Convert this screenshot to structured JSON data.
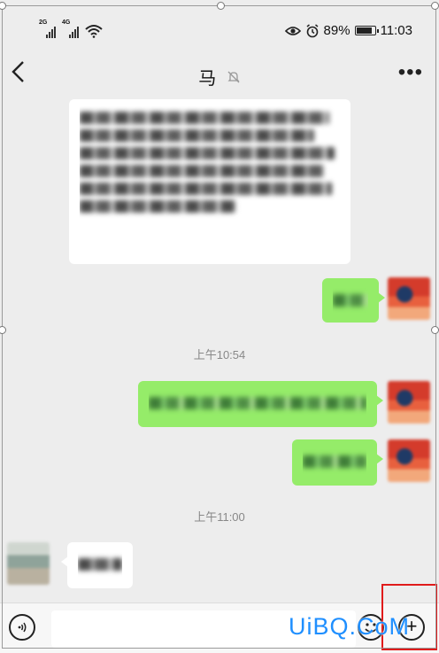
{
  "status_bar": {
    "net1": "2G",
    "net2": "4G",
    "battery": "89%",
    "battery_level": 0.89,
    "time": "11:03"
  },
  "header": {
    "title": "马",
    "back_icon": "chevron-left-icon",
    "mute_icon": "bell-off-icon",
    "more_icon": "ellipsis-icon"
  },
  "timestamps": {
    "first": "上午10:54",
    "second": "上午11:00"
  },
  "input_bar": {
    "placeholder": "",
    "voice_icon": "voice-icon",
    "emoji_icon": "emoji-icon",
    "plus_icon": "plus-icon"
  },
  "watermark": "UiBQ.CoM",
  "colors": {
    "sent_bubble": "#95ec69",
    "received_bubble": "#ffffff",
    "background": "#ededed",
    "annotation": "#e01b1b",
    "watermark": "#1f8fff"
  }
}
